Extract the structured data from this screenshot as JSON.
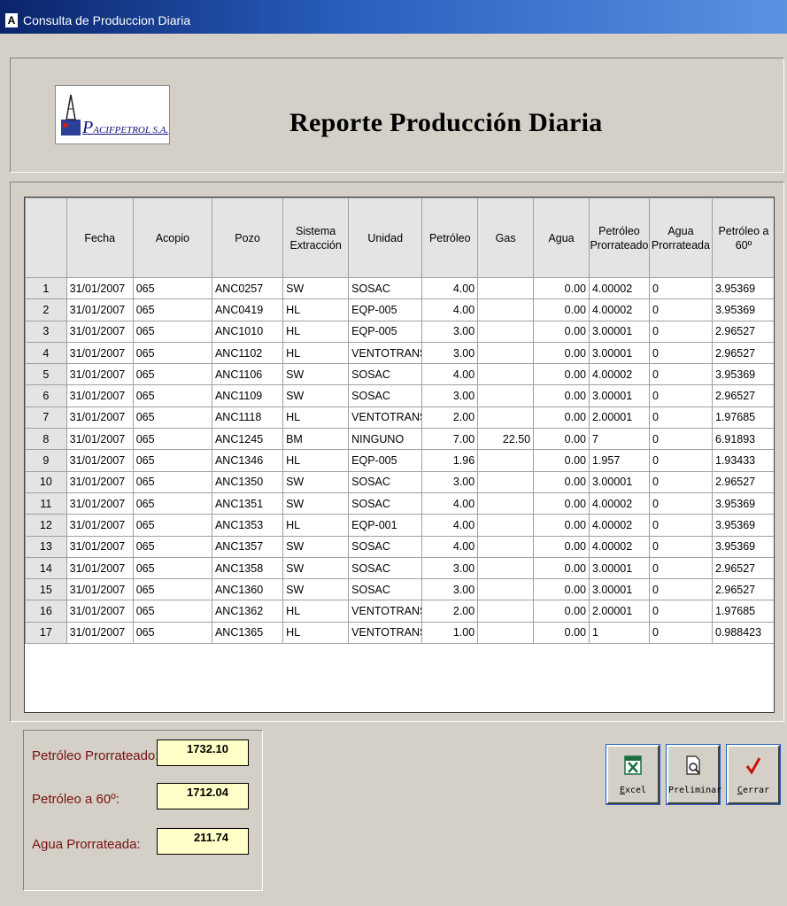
{
  "window": {
    "title": "Consulta de Produccion Diaria"
  },
  "header": {
    "logo_text_first": "P",
    "logo_text_rest": "ACIFPETROL S.A.",
    "report_title": "Reporte Producción Diaria"
  },
  "grid": {
    "columns": [
      "",
      "Fecha",
      "Acopio",
      "Pozo",
      "Sistema Extracción",
      "Unidad",
      "Petróleo",
      "Gas",
      "Agua",
      "Petróleo Prorrateado",
      "Agua Prorrateada",
      "Petróleo a 60º"
    ],
    "rows": [
      [
        "1",
        "31/01/2007",
        "065",
        "ANC0257",
        "SW",
        "SOSAC",
        "4.00",
        "",
        "0.00",
        "4.00002",
        "0",
        "3.95369"
      ],
      [
        "2",
        "31/01/2007",
        "065",
        "ANC0419",
        "HL",
        "EQP-005",
        "4.00",
        "",
        "0.00",
        "4.00002",
        "0",
        "3.95369"
      ],
      [
        "3",
        "31/01/2007",
        "065",
        "ANC1010",
        "HL",
        "EQP-005",
        "3.00",
        "",
        "0.00",
        "3.00001",
        "0",
        "2.96527"
      ],
      [
        "4",
        "31/01/2007",
        "065",
        "ANC1102",
        "HL",
        "VENTOTRANS",
        "3.00",
        "",
        "0.00",
        "3.00001",
        "0",
        "2.96527"
      ],
      [
        "5",
        "31/01/2007",
        "065",
        "ANC1106",
        "SW",
        "SOSAC",
        "4.00",
        "",
        "0.00",
        "4.00002",
        "0",
        "3.95369"
      ],
      [
        "6",
        "31/01/2007",
        "065",
        "ANC1109",
        "SW",
        "SOSAC",
        "3.00",
        "",
        "0.00",
        "3.00001",
        "0",
        "2.96527"
      ],
      [
        "7",
        "31/01/2007",
        "065",
        "ANC1118",
        "HL",
        "VENTOTRANS",
        "2.00",
        "",
        "0.00",
        "2.00001",
        "0",
        "1.97685"
      ],
      [
        "8",
        "31/01/2007",
        "065",
        "ANC1245",
        "BM",
        "NINGUNO",
        "7.00",
        "22.50",
        "0.00",
        "7",
        "0",
        "6.91893"
      ],
      [
        "9",
        "31/01/2007",
        "065",
        "ANC1346",
        "HL",
        "EQP-005",
        "1.96",
        "",
        "0.00",
        "1.957",
        "0",
        "1.93433"
      ],
      [
        "10",
        "31/01/2007",
        "065",
        "ANC1350",
        "SW",
        "SOSAC",
        "3.00",
        "",
        "0.00",
        "3.00001",
        "0",
        "2.96527"
      ],
      [
        "11",
        "31/01/2007",
        "065",
        "ANC1351",
        "SW",
        "SOSAC",
        "4.00",
        "",
        "0.00",
        "4.00002",
        "0",
        "3.95369"
      ],
      [
        "12",
        "31/01/2007",
        "065",
        "ANC1353",
        "HL",
        "EQP-001",
        "4.00",
        "",
        "0.00",
        "4.00002",
        "0",
        "3.95369"
      ],
      [
        "13",
        "31/01/2007",
        "065",
        "ANC1357",
        "SW",
        "SOSAC",
        "4.00",
        "",
        "0.00",
        "4.00002",
        "0",
        "3.95369"
      ],
      [
        "14",
        "31/01/2007",
        "065",
        "ANC1358",
        "SW",
        "SOSAC",
        "3.00",
        "",
        "0.00",
        "3.00001",
        "0",
        "2.96527"
      ],
      [
        "15",
        "31/01/2007",
        "065",
        "ANC1360",
        "SW",
        "SOSAC",
        "3.00",
        "",
        "0.00",
        "3.00001",
        "0",
        "2.96527"
      ],
      [
        "16",
        "31/01/2007",
        "065",
        "ANC1362",
        "HL",
        "VENTOTRANS",
        "2.00",
        "",
        "0.00",
        "2.00001",
        "0",
        "1.97685"
      ],
      [
        "17",
        "31/01/2007",
        "065",
        "ANC1365",
        "HL",
        "VENTOTRANS",
        "1.00",
        "",
        "0.00",
        "1",
        "0",
        "0.988423"
      ]
    ]
  },
  "totals": {
    "petroleo_prorrateado_label": "Petróleo Prorrateado:",
    "petroleo_prorrateado_value": "1732.10",
    "petroleo_60_label": "Petróleo a 60º:",
    "petroleo_60_value": "1712.04",
    "agua_prorrateada_label": "Agua Prorrateada:",
    "agua_prorrateada_value": "211.74"
  },
  "buttons": {
    "excel": {
      "mnemonic": "E",
      "rest": "xcel",
      "icon": "excel-icon"
    },
    "preliminar": {
      "label": "Preliminar",
      "icon": "print-preview-icon"
    },
    "cerrar": {
      "mnemonic": "C",
      "rest": "errar",
      "icon": "checkmark-icon"
    }
  },
  "colors": {
    "title_bar": "#0a246a",
    "total_label": "#7a1010",
    "total_box": "#ffffc8"
  }
}
